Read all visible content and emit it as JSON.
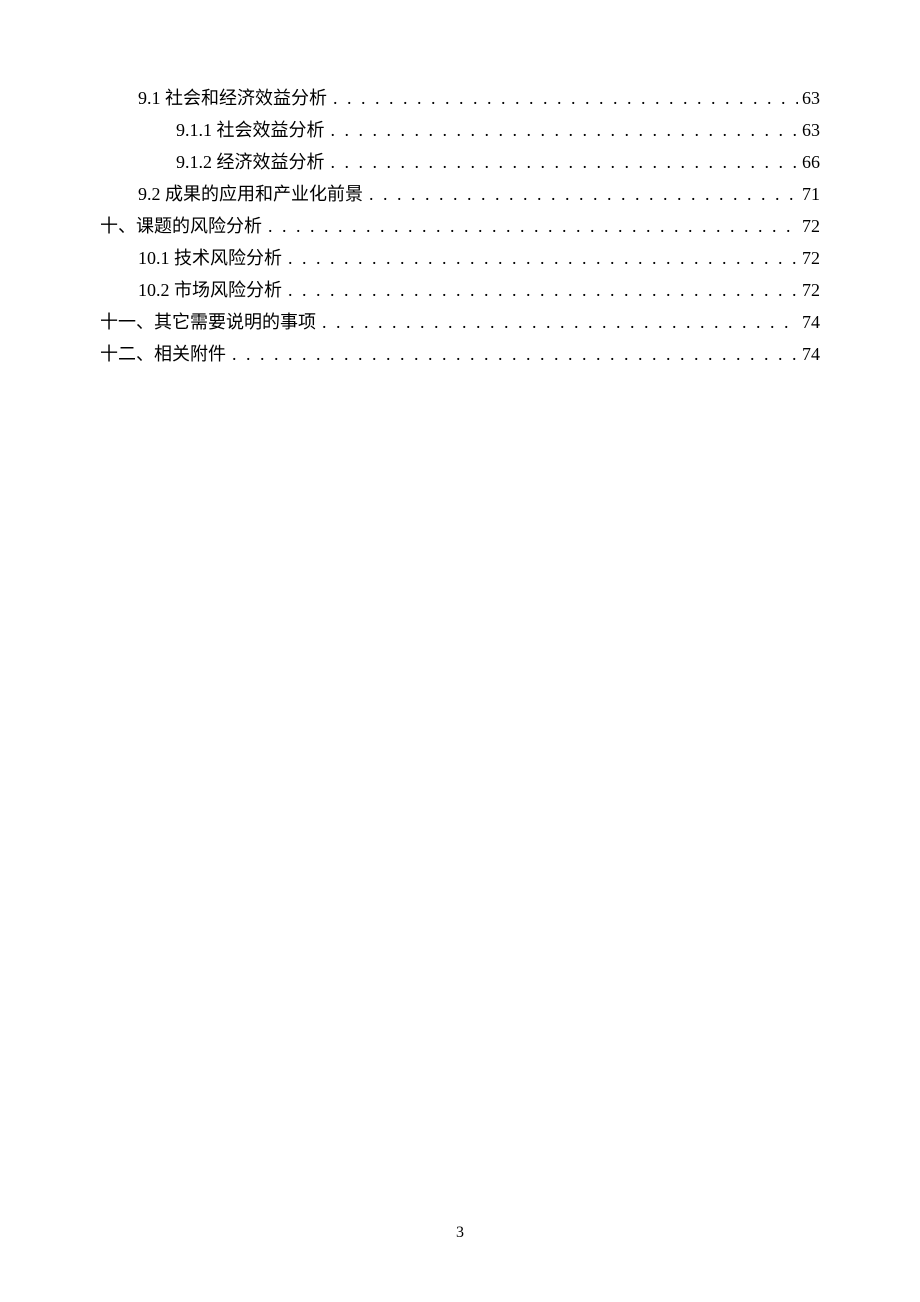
{
  "toc": {
    "entries": [
      {
        "indent": 1,
        "label": "9.1  社会和经济效益分析",
        "page": "63"
      },
      {
        "indent": 2,
        "label": "9.1.1  社会效益分析",
        "page": "63"
      },
      {
        "indent": 2,
        "label": "9.1.2  经济效益分析",
        "page": "66"
      },
      {
        "indent": 1,
        "label": "9.2 成果的应用和产业化前景",
        "page": "71"
      },
      {
        "indent": 0,
        "label": "十、课题的风险分析",
        "page": "72"
      },
      {
        "indent": 1,
        "label": "10.1  技术风险分析",
        "page": "72"
      },
      {
        "indent": 1,
        "label": "10.2  市场风险分析",
        "page": "72"
      },
      {
        "indent": 0,
        "label": "十一、其它需要说明的事项",
        "page": "74"
      },
      {
        "indent": 0,
        "label": "十二、相关附件",
        "page": "74"
      }
    ]
  },
  "pageNumber": "3"
}
